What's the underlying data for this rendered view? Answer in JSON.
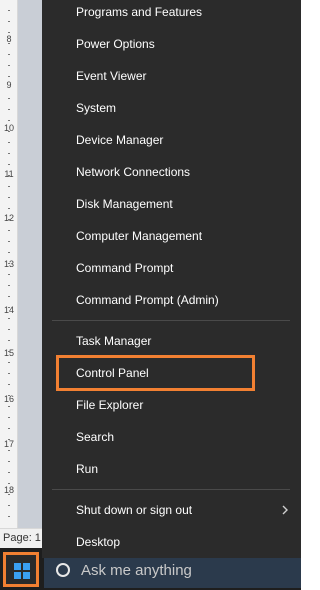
{
  "document": {
    "ruler_numbers": [
      "8",
      "9",
      "10",
      "11",
      "12",
      "13",
      "14",
      "15",
      "16",
      "17",
      "18"
    ],
    "status_text": "Page: 1"
  },
  "menu": {
    "group1": [
      {
        "label": "Programs and Features",
        "name": "menu-item-programs-and-features"
      },
      {
        "label": "Power Options",
        "name": "menu-item-power-options"
      },
      {
        "label": "Event Viewer",
        "name": "menu-item-event-viewer"
      },
      {
        "label": "System",
        "name": "menu-item-system"
      },
      {
        "label": "Device Manager",
        "name": "menu-item-device-manager"
      },
      {
        "label": "Network Connections",
        "name": "menu-item-network-connections"
      },
      {
        "label": "Disk Management",
        "name": "menu-item-disk-management"
      },
      {
        "label": "Computer Management",
        "name": "menu-item-computer-management"
      },
      {
        "label": "Command Prompt",
        "name": "menu-item-command-prompt"
      },
      {
        "label": "Command Prompt (Admin)",
        "name": "menu-item-command-prompt-admin"
      }
    ],
    "group2": [
      {
        "label": "Task Manager",
        "name": "menu-item-task-manager"
      },
      {
        "label": "Control Panel",
        "name": "menu-item-control-panel",
        "highlighted": true
      },
      {
        "label": "File Explorer",
        "name": "menu-item-file-explorer"
      },
      {
        "label": "Search",
        "name": "menu-item-search"
      },
      {
        "label": "Run",
        "name": "menu-item-run"
      }
    ],
    "group3": [
      {
        "label": "Shut down or sign out",
        "name": "menu-item-shut-down",
        "has_submenu": true
      },
      {
        "label": "Desktop",
        "name": "menu-item-desktop"
      }
    ]
  },
  "taskbar": {
    "search_placeholder": "Ask me anything"
  },
  "colors": {
    "menu_bg": "#2b2b2b",
    "highlight": "#f28032",
    "taskbar_bg": "#1e1e1e",
    "search_bg": "#2b3a4c",
    "windows_blue": "#3aa0f2"
  }
}
